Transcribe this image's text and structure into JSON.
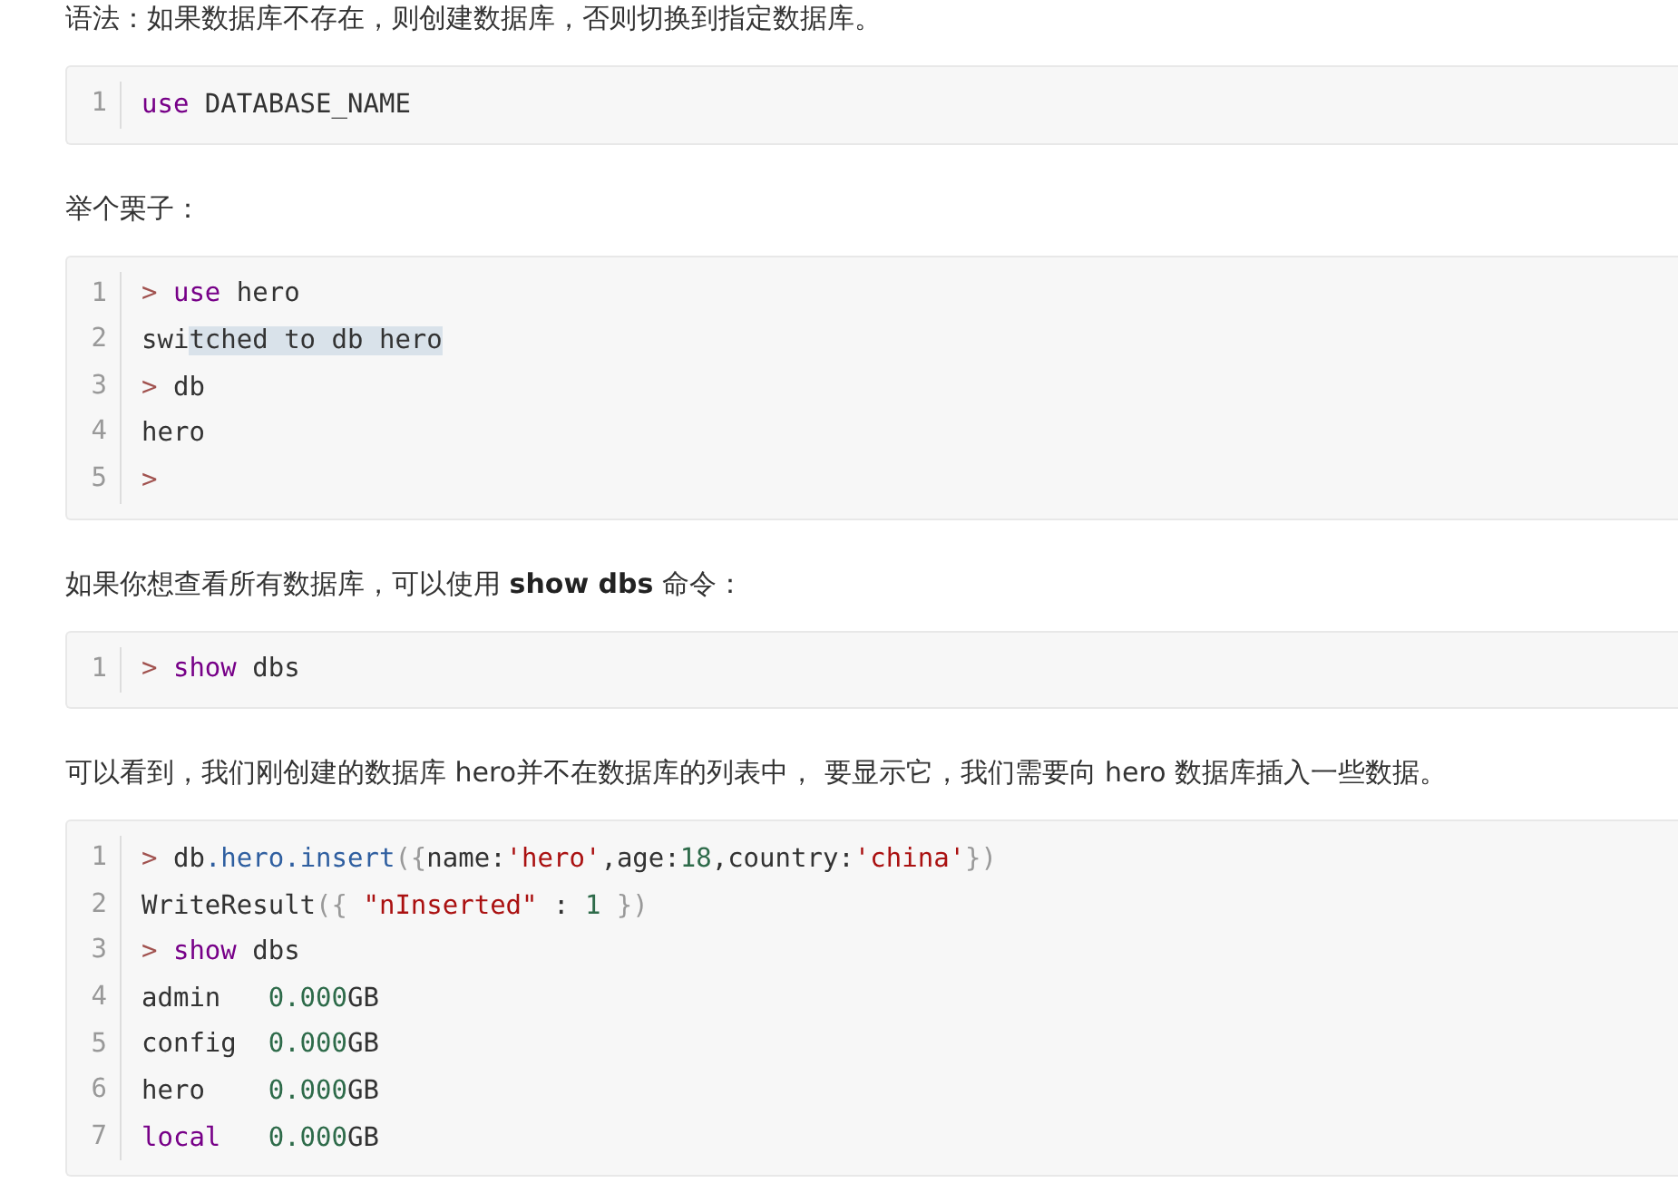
{
  "blocks": [
    {
      "kind": "paragraph",
      "text": "语法：如果数据库不存在，则创建数据库，否则切换到指定数据库。"
    },
    {
      "kind": "code",
      "lines": [
        {
          "number": "1",
          "tokens": [
            {
              "kind": "keyword",
              "text": "use"
            },
            {
              "kind": "plain",
              "text": " DATABASE_NAME"
            }
          ]
        }
      ]
    },
    {
      "kind": "paragraph",
      "text": "举个栗子："
    },
    {
      "kind": "code",
      "lines": [
        {
          "number": "1",
          "tokens": [
            {
              "kind": "prompt",
              "text": ">"
            },
            {
              "kind": "keyword",
              "text": " use"
            },
            {
              "kind": "plain",
              "text": " hero"
            }
          ]
        },
        {
          "number": "2",
          "tokens": [
            {
              "kind": "plain",
              "text": "swi"
            },
            {
              "kind": "selection",
              "text": "tched to db hero"
            }
          ]
        },
        {
          "number": "3",
          "tokens": [
            {
              "kind": "prompt",
              "text": ">"
            },
            {
              "kind": "plain",
              "text": " db"
            }
          ]
        },
        {
          "number": "4",
          "tokens": [
            {
              "kind": "plain",
              "text": "hero"
            }
          ]
        },
        {
          "number": "5",
          "tokens": [
            {
              "kind": "prompt",
              "text": ">"
            }
          ]
        }
      ]
    },
    {
      "kind": "paragraph",
      "text": "如果你想查看所有数据库，可以使用 **show dbs** 命令："
    },
    {
      "kind": "code",
      "lines": [
        {
          "number": "1",
          "tokens": [
            {
              "kind": "prompt",
              "text": ">"
            },
            {
              "kind": "keyword",
              "text": " show"
            },
            {
              "kind": "plain",
              "text": " dbs"
            }
          ]
        }
      ]
    },
    {
      "kind": "paragraph",
      "text": "可以看到，我们刚创建的数据库 hero并不在数据库的列表中， 要显示它，我们需要向 hero 数据库插入一些数据。"
    },
    {
      "kind": "code",
      "lines": [
        {
          "number": "1",
          "tokens": [
            {
              "kind": "prompt",
              "text": ">"
            },
            {
              "kind": "plain",
              "text": " db"
            },
            {
              "kind": "property",
              "text": ".hero.insert"
            },
            {
              "kind": "punct",
              "text": "({"
            },
            {
              "kind": "plain",
              "text": "name:"
            },
            {
              "kind": "string",
              "text": "'hero'"
            },
            {
              "kind": "plain",
              "text": ",age:"
            },
            {
              "kind": "number",
              "text": "18"
            },
            {
              "kind": "plain",
              "text": ",country:"
            },
            {
              "kind": "string",
              "text": "'china'"
            },
            {
              "kind": "punct",
              "text": "})"
            }
          ]
        },
        {
          "number": "2",
          "tokens": [
            {
              "kind": "plain",
              "text": "WriteResult"
            },
            {
              "kind": "punct",
              "text": "({ "
            },
            {
              "kind": "string",
              "text": "\"nInserted\""
            },
            {
              "kind": "plain",
              "text": " : "
            },
            {
              "kind": "number",
              "text": "1"
            },
            {
              "kind": "punct",
              "text": " })"
            }
          ]
        },
        {
          "number": "3",
          "tokens": [
            {
              "kind": "prompt",
              "text": ">"
            },
            {
              "kind": "keyword",
              "text": " show"
            },
            {
              "kind": "plain",
              "text": " dbs"
            }
          ]
        },
        {
          "number": "4",
          "tokens": [
            {
              "kind": "plain",
              "text": "admin   "
            },
            {
              "kind": "number",
              "text": "0.000"
            },
            {
              "kind": "plain",
              "text": "GB"
            }
          ]
        },
        {
          "number": "5",
          "tokens": [
            {
              "kind": "plain",
              "text": "config  "
            },
            {
              "kind": "number",
              "text": "0.000"
            },
            {
              "kind": "plain",
              "text": "GB"
            }
          ]
        },
        {
          "number": "6",
          "tokens": [
            {
              "kind": "plain",
              "text": "hero    "
            },
            {
              "kind": "number",
              "text": "0.000"
            },
            {
              "kind": "plain",
              "text": "GB"
            }
          ]
        },
        {
          "number": "7",
          "tokens": [
            {
              "kind": "keyword",
              "text": "local"
            },
            {
              "kind": "number",
              "text": "   0.000"
            },
            {
              "kind": "plain",
              "text": "GB"
            }
          ]
        }
      ]
    }
  ]
}
